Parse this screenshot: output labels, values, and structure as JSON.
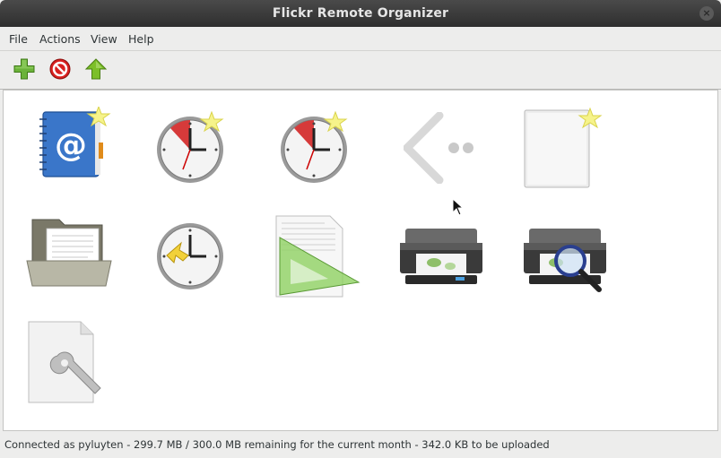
{
  "window": {
    "title": "Flickr Remote Organizer"
  },
  "menu": {
    "items": [
      "File",
      "Actions",
      "View",
      "Help"
    ]
  },
  "toolbar": {
    "buttons": [
      "add-icon",
      "remove-icon",
      "upload-icon"
    ]
  },
  "icons": [
    "address-book-new-icon",
    "alarm-clock-new-icon",
    "alarm-clock-new-icon",
    "go-previous-icon",
    "new-document-icon",
    "folder-open-document-icon",
    "history-clock-icon",
    "page-setup-icon",
    "printer-icon",
    "print-preview-icon",
    "preferences-document-icon"
  ],
  "status": {
    "text": "Connected as pyluyten - 299.7 MB / 300.0 MB remaining for the current month - 342.0 KB to be uploaded"
  },
  "colors": {
    "titlebar": "#3a3a3a",
    "add": "#5aa02c",
    "remove": "#cc0000",
    "upload": "#73b020"
  }
}
